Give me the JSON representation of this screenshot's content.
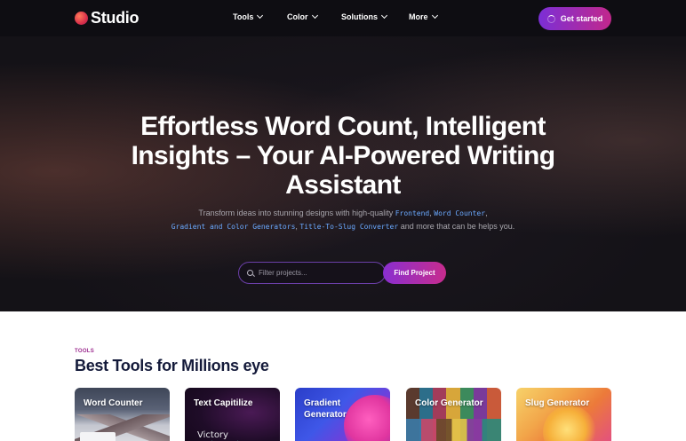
{
  "brand": {
    "name": "Studio"
  },
  "nav": {
    "items": [
      {
        "label": "Tools"
      },
      {
        "label": "Color"
      },
      {
        "label": "Solutions"
      },
      {
        "label": "More"
      }
    ],
    "cta_label": "Get started"
  },
  "hero": {
    "title": "Effortless Word Count, Intelligent Insights – Your AI-Powered Writing Assistant",
    "subtitle": {
      "intro": "Transform ideas into stunning designs with high-quality ",
      "tool_frontend": "Frontend",
      "sep1": ", ",
      "tool_word_counter": "Word Counter",
      "sep2": ", ",
      "tool_gradient": "Gradient and Color Generators",
      "sep3": ", ",
      "tool_slug": "Title-To-Slug Converter",
      "outro": " and more that can be helps you."
    },
    "search_placeholder": "Filter projects...",
    "search_button": "Find Project"
  },
  "tools_section": {
    "eyebrow": "TOOLS",
    "title": "Best Tools for Millions eye",
    "cards": [
      {
        "label": "Word Counter"
      },
      {
        "label": "Text Capitilize",
        "image_text": "Victory"
      },
      {
        "label": "Gradient Generator"
      },
      {
        "label": "Color Generator"
      },
      {
        "label": "Slug Generator"
      }
    ]
  },
  "colors": {
    "accent_start": "#7b2fd6",
    "accent_end": "#c2288c",
    "code_highlight": "#6aa9ff",
    "heading_dark": "#141a3a",
    "eyebrow": "#9b2a8e"
  },
  "icons": {
    "logo": "studio-logo-mark",
    "search": "search-icon",
    "loading": "spinner-icon",
    "dropdown": "chevron-down-icon"
  }
}
